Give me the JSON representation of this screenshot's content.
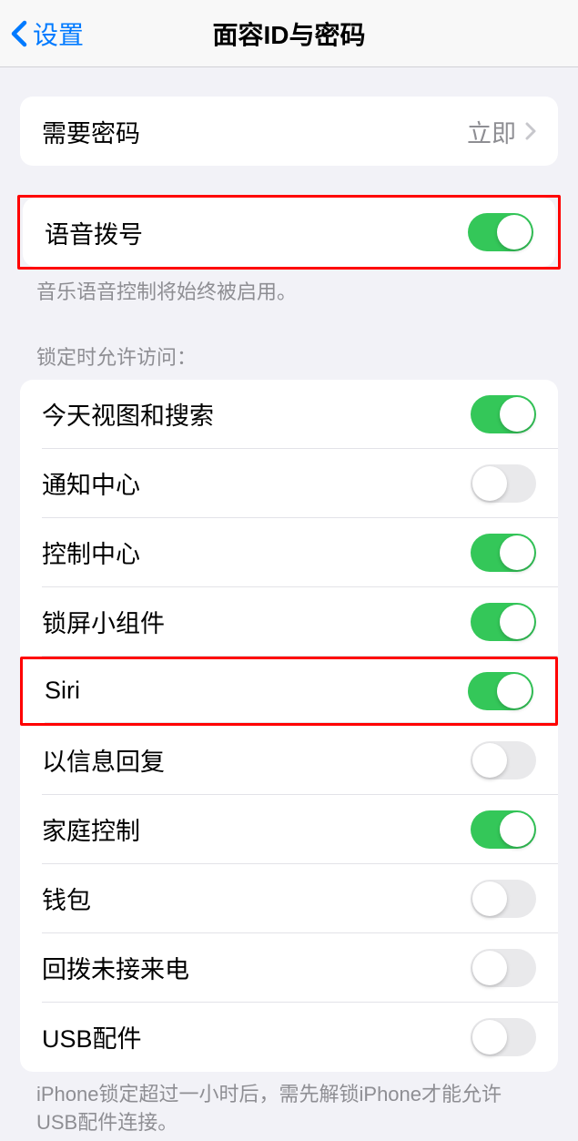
{
  "nav": {
    "back_label": "设置",
    "title": "面容ID与密码"
  },
  "passcode_section": {
    "require_passcode": {
      "label": "需要密码",
      "value": "立即"
    }
  },
  "voice_section": {
    "voice_dial": {
      "label": "语音拨号",
      "on": true
    },
    "footer": "音乐语音控制将始终被启用。"
  },
  "lock_section": {
    "header": "锁定时允许访问：",
    "items": [
      {
        "key": "today-search",
        "label": "今天视图和搜索",
        "on": true
      },
      {
        "key": "notification-center",
        "label": "通知中心",
        "on": false
      },
      {
        "key": "control-center",
        "label": "控制中心",
        "on": true
      },
      {
        "key": "lock-widgets",
        "label": "锁屏小组件",
        "on": true
      },
      {
        "key": "siri",
        "label": "Siri",
        "on": true
      },
      {
        "key": "reply-message",
        "label": "以信息回复",
        "on": false
      },
      {
        "key": "home-control",
        "label": "家庭控制",
        "on": true
      },
      {
        "key": "wallet",
        "label": "钱包",
        "on": false
      },
      {
        "key": "return-calls",
        "label": "回拨未接来电",
        "on": false
      },
      {
        "key": "usb",
        "label": "USB配件",
        "on": false
      }
    ],
    "footer": "iPhone锁定超过一小时后，需先解锁iPhone才能允许USB配件连接。"
  }
}
